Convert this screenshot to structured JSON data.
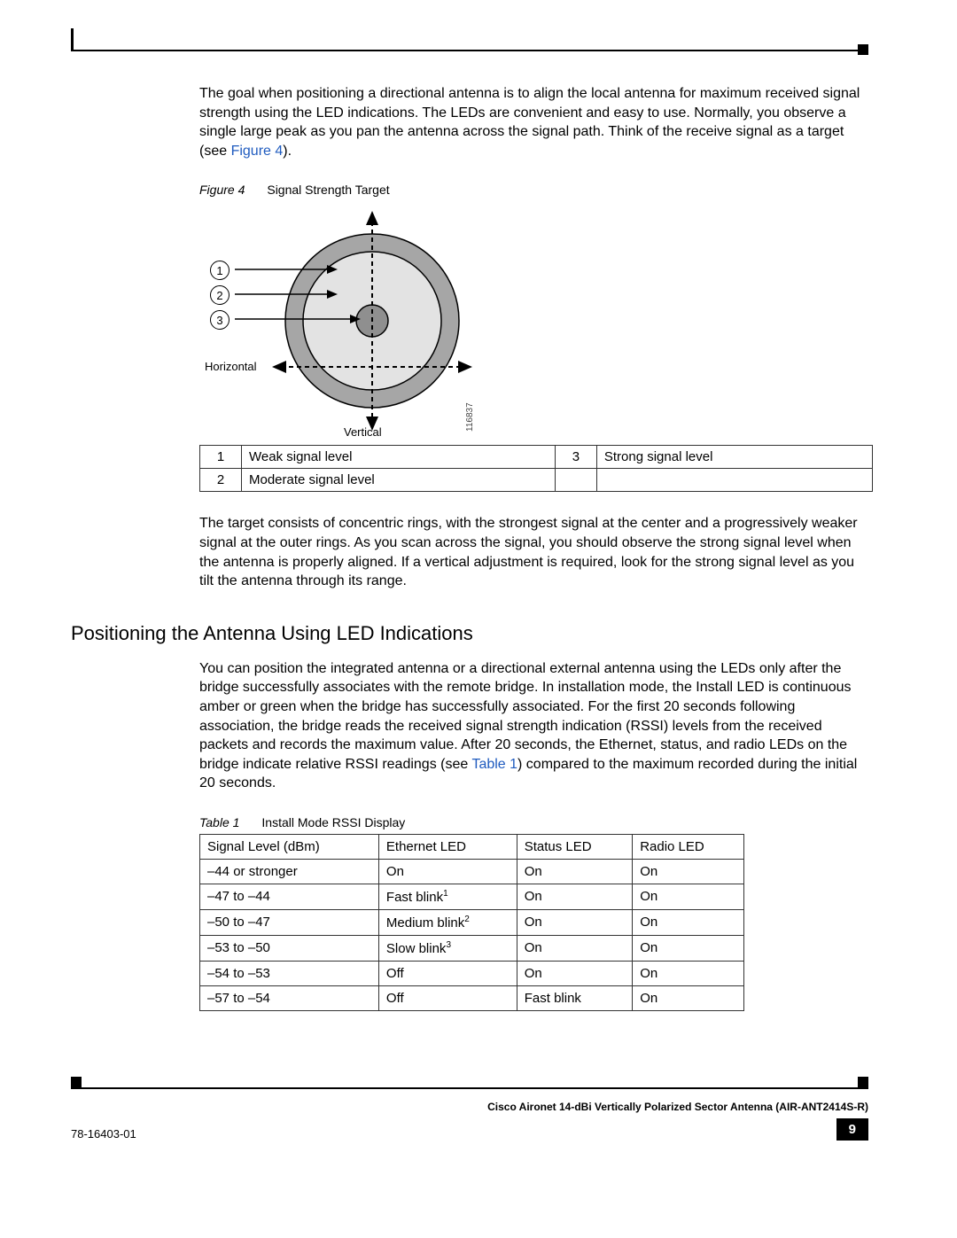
{
  "para1_a": "The goal when positioning a directional antenna is to align the local antenna for maximum received signal strength using the LED indications. The LEDs are convenient and easy to use. Normally, you observe a single large peak as you pan the antenna across the signal path. Think of the receive signal as a target (see ",
  "para1_link": "Figure 4",
  "para1_b": ").",
  "figure_label_prefix": "Figure 4",
  "figure_label_title": "Signal Strength Target",
  "callout1": "1",
  "callout2": "2",
  "callout3": "3",
  "axis_h": "Horizontal",
  "axis_v": "Vertical",
  "svg_id": "116837",
  "legend": {
    "r1c1": "1",
    "r1c2": "Weak signal level",
    "r1c3": "3",
    "r1c4": "Strong signal level",
    "r2c1": "2",
    "r2c2": "Moderate signal level",
    "r2c3": "",
    "r2c4": ""
  },
  "para2": "The target consists of concentric rings, with the strongest signal at the center and a progressively weaker signal at the outer rings. As you scan across the signal, you should observe the strong signal level when the antenna is properly aligned. If a vertical adjustment is required, look for the strong signal level as you tilt the antenna through its range.",
  "heading": "Positioning the Antenna Using LED Indications",
  "para3_a": "You can position the integrated antenna or a directional external antenna using the LEDs only after the bridge successfully associates with the remote bridge. In installation mode, the Install LED is continuous amber or green when the bridge has successfully associated. For the first 20 seconds following association, the bridge reads the received signal strength indication (RSSI) levels from the received packets and records the maximum value. After 20 seconds, the Ethernet, status, and radio LEDs on the bridge indicate relative RSSI readings (see ",
  "para3_link": "Table 1",
  "para3_b": ") compared to the maximum recorded during the initial 20 seconds.",
  "table_label_prefix": "Table 1",
  "table_label_title": "Install Mode RSSI Display",
  "headers": {
    "c1": "Signal Level (dBm)",
    "c2": "Ethernet LED",
    "c3": "Status LED",
    "c4": "Radio LED"
  },
  "rows": [
    {
      "c1": "–44 or stronger",
      "c2": "On",
      "c3": "On",
      "c4": "On"
    },
    {
      "c1": "–47 to –44",
      "c2": "Fast blink",
      "c2sup": "1",
      "c3": "On",
      "c4": "On"
    },
    {
      "c1": "–50 to –47",
      "c2": "Medium blink",
      "c2sup": "2",
      "c3": "On",
      "c4": "On"
    },
    {
      "c1": "–53 to –50",
      "c2": "Slow blink",
      "c2sup": "3",
      "c3": "On",
      "c4": "On"
    },
    {
      "c1": "–54 to –53",
      "c2": "Off",
      "c3": "On",
      "c4": "On"
    },
    {
      "c1": "–57 to –54",
      "c2": "Off",
      "c3": "Fast blink",
      "c4": "On"
    }
  ],
  "footer_doc": "Cisco Aironet 14-dBi Vertically Polarized Sector Antenna (AIR-ANT2414S-R)",
  "footer_partnum": "78-16403-01",
  "page_number": "9"
}
